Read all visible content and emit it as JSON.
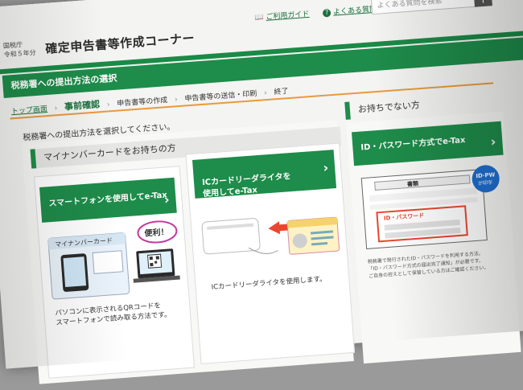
{
  "header": {
    "agency": "国税庁",
    "year": "令和５年分",
    "title": "確定申告書等作成コーナー",
    "guide_link": "ご利用ガイド",
    "faq_link": "よくある質問",
    "search_placeholder": "よくある質問を検索"
  },
  "page_heading": "税務署への提出方法の選択",
  "breadcrumb": {
    "home": "トップ画面",
    "current": "事前確認",
    "steps": [
      "申告書等の作成",
      "申告書等の送信・印刷",
      "終了"
    ]
  },
  "intro": "税務署への提出方法を選択してください。",
  "mynumber_section": {
    "heading": "マイナンバーカードをお持ちの方",
    "smartphone": {
      "button": "スマートフォンを使用してe-Tax",
      "card_label": "マイナンバーカード",
      "bubble": "便利！",
      "caption": "パソコンに表示されるQRコードを\nスマートフォンで読み取る方法です。"
    },
    "icreader": {
      "button": "ICカードリーダライタを\n使用してe-Tax",
      "caption": "ICカードリーダライタを使用します。"
    }
  },
  "no_card_section": {
    "heading": "お持ちでない方",
    "button": "ID・パスワード方式でe-Tax",
    "doc_title": "書類",
    "badge": "ID・PW\nが印字",
    "id_label": "ID・パスワード",
    "caption": "税務署で発行されたID・パスワードを利用する方法。\n「ID・パスワード方式の届出完了通知」が必要です。\nご自身の控えとして保管している方はご確認ください。"
  },
  "colors": {
    "brand_green": "#1e8c4a",
    "accent_orange": "#e89a3c",
    "magenta": "#c43aa0"
  }
}
